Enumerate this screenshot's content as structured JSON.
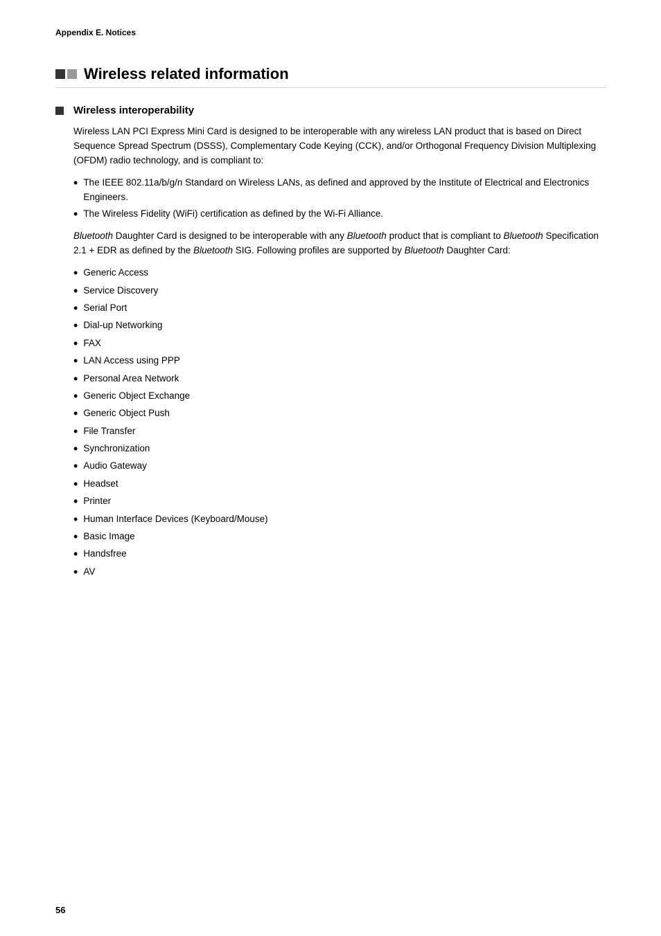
{
  "appendix": {
    "label": "Appendix E. Notices"
  },
  "section": {
    "title": "Wireless related information",
    "subsections": [
      {
        "title": "Wireless interoperability",
        "paragraphs": [
          {
            "text": "Wireless LAN PCI Express Mini Card is designed to be interoperable with any wireless LAN product that is based on Direct Sequence Spread Spectrum (DSSS), Complementary Code Keying (CCK), and/or Orthogonal Frequency Division Multiplexing (OFDM) radio technology, and is compliant to:",
            "italic": false
          }
        ],
        "ieee_bullets": [
          "The IEEE 802.11a/b/g/n Standard on Wireless LANs, as defined and approved by the Institute of Electrical and Electronics Engineers.",
          "The Wireless Fidelity (WiFi) certification as defined by the Wi-Fi Alliance."
        ],
        "bluetooth_intro": {
          "pre_italic_1": "",
          "italic_1": "Bluetooth",
          "mid_1": " Daughter Card is designed to be interoperable with any ",
          "italic_2": "Bluetooth",
          "mid_2": " product that is compliant to ",
          "italic_3": "Bluetooth",
          "mid_3": " Specification 2.1 + EDR as defined by the ",
          "italic_4": "Bluetooth",
          "mid_4": " SIG. Following profiles are supported by ",
          "italic_5": "Bluetooth",
          "end": " Daughter Card:"
        },
        "profile_list": [
          "Generic Access",
          "Service Discovery",
          "Serial Port",
          "Dial-up Networking",
          "FAX",
          "LAN Access using PPP",
          "Personal Area Network",
          "Generic Object Exchange",
          "Generic Object Push",
          "File Transfer",
          "Synchronization",
          "Audio Gateway",
          "Headset",
          "Printer",
          "Human Interface Devices (Keyboard/Mouse)",
          "Basic Image",
          "Handsfree",
          "AV"
        ]
      }
    ]
  },
  "page_number": "56"
}
